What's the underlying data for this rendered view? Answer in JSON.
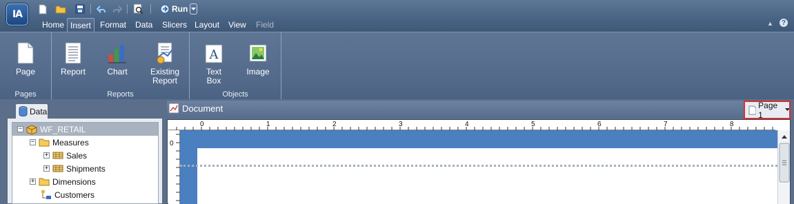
{
  "app": {
    "logo_text": "IA"
  },
  "quick_access": {
    "run_label": "Run"
  },
  "tabs": [
    {
      "label": "Home"
    },
    {
      "label": "Insert"
    },
    {
      "label": "Format"
    },
    {
      "label": "Data"
    },
    {
      "label": "Slicers"
    },
    {
      "label": "Layout"
    },
    {
      "label": "View"
    },
    {
      "label": "Field"
    }
  ],
  "ribbon": {
    "groups": [
      {
        "label": "Pages",
        "buttons": [
          {
            "label": "Page",
            "icon": "page-icon"
          }
        ]
      },
      {
        "label": "Reports",
        "buttons": [
          {
            "label": "Report",
            "icon": "report-icon"
          },
          {
            "label": "Chart",
            "icon": "chart-icon"
          },
          {
            "label": "Existing Report",
            "line1": "Existing",
            "line2": "Report",
            "icon": "existing-report-icon"
          }
        ]
      },
      {
        "label": "Objects",
        "buttons": [
          {
            "label": "Text Box",
            "line1": "Text",
            "line2": "Box",
            "icon": "text-box-icon"
          },
          {
            "label": "Image",
            "icon": "image-icon"
          }
        ]
      }
    ]
  },
  "data_panel": {
    "tab_label": "Data",
    "tree": [
      {
        "label": "WF_RETAIL",
        "expander": "−"
      },
      {
        "label": "Measures",
        "expander": "−"
      },
      {
        "label": "Sales",
        "expander": "+"
      },
      {
        "label": "Shipments",
        "expander": "+"
      },
      {
        "label": "Dimensions",
        "expander": "+"
      },
      {
        "label": "Customers",
        "expander": ""
      }
    ]
  },
  "document": {
    "title": "Document",
    "page_selector": "Page 1",
    "ruler_numbers": [
      "0",
      "1",
      "2",
      "3",
      "4",
      "5",
      "6",
      "7",
      "8"
    ],
    "vruler_start": "0"
  }
}
